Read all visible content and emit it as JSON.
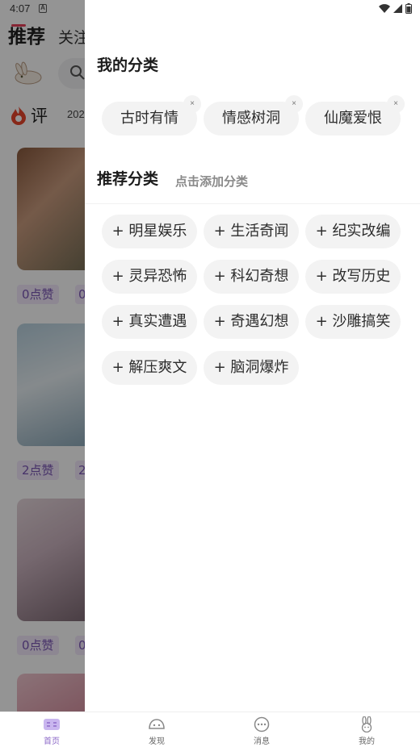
{
  "status_bar": {
    "time": "4:07",
    "notif_letter": "A"
  },
  "background": {
    "tabs": {
      "recommend": "推荐",
      "follow": "关注"
    },
    "section_label": "评",
    "year_text": "202",
    "likes": [
      "0点赞",
      "2点赞",
      "0点赞"
    ],
    "likes_partial": [
      "0",
      "2",
      "0"
    ]
  },
  "drawer": {
    "my_categories_title": "我的分类",
    "my_categories": [
      {
        "label": "古时有情",
        "close": "×"
      },
      {
        "label": "情感树洞",
        "close": "×"
      },
      {
        "label": "仙魔爱恨",
        "close": "×"
      }
    ],
    "recommend_title": "推荐分类",
    "recommend_hint": "点击添加分类",
    "recommended": [
      "+ 明星娱乐",
      "+ 生活奇闻",
      "+ 纪实改编",
      "+ 灵异恐怖",
      "+ 科幻奇想",
      "+ 改写历史",
      "+ 真实遭遇",
      "+ 奇遇幻想",
      "+ 沙雕搞笑",
      "+ 解压爽文",
      "+ 脑洞爆炸"
    ]
  },
  "bottom_nav": {
    "items": [
      {
        "label": "首页",
        "icon": "home-icon",
        "active": true
      },
      {
        "label": "发现",
        "icon": "discover-icon",
        "active": false
      },
      {
        "label": "消息",
        "icon": "message-icon",
        "active": false
      },
      {
        "label": "我的",
        "icon": "profile-rabbit-icon",
        "active": false
      }
    ]
  },
  "colors": {
    "accent": "#8c69c8",
    "chip_bg": "#f3f3f3",
    "overlay": "rgba(0,0,0,0.42)"
  }
}
